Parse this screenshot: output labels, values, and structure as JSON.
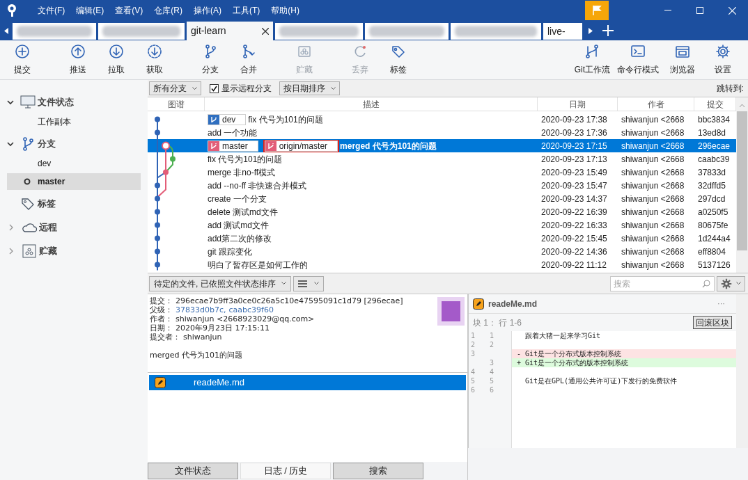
{
  "menu": [
    "文件(F)",
    "编辑(E)",
    "查看(V)",
    "仓库(R)",
    "操作(A)",
    "工具(T)",
    "帮助(H)"
  ],
  "tabs": [
    {
      "kind": "blurred",
      "selected": false
    },
    {
      "kind": "blurred",
      "selected": false
    },
    {
      "kind": "named",
      "label": "git-learn",
      "selected": true
    },
    {
      "kind": "blurred",
      "selected": false
    },
    {
      "kind": "blurred",
      "selected": false
    },
    {
      "kind": "blurred",
      "selected": false
    },
    {
      "kind": "named",
      "label": "live-",
      "selected": false
    }
  ],
  "toolbar": {
    "left": [
      {
        "label": "提交",
        "disabled": false
      },
      {
        "label": "推送",
        "disabled": false
      },
      {
        "label": "拉取",
        "disabled": false
      },
      {
        "label": "获取",
        "disabled": false
      },
      {
        "label": "分支",
        "disabled": false
      },
      {
        "label": "合并",
        "disabled": false
      },
      {
        "label": "贮藏",
        "disabled": true
      },
      {
        "label": "丢弃",
        "disabled": true
      },
      {
        "label": "标签",
        "disabled": false
      }
    ],
    "right": [
      {
        "label": "Git工作流",
        "disabled": false
      },
      {
        "label": "命令行模式",
        "disabled": false
      },
      {
        "label": "浏览器",
        "disabled": false
      },
      {
        "label": "设置",
        "disabled": false
      }
    ]
  },
  "sidebar": [
    {
      "label": "文件状态",
      "kind": "expandable",
      "expanded": true,
      "children": [
        {
          "label": "工作副本",
          "current": false,
          "selected": false
        }
      ]
    },
    {
      "label": "分支",
      "kind": "expandable",
      "expanded": true,
      "children": [
        {
          "label": "dev",
          "current": false,
          "selected": false
        },
        {
          "label": "master",
          "current": true,
          "selected": true
        }
      ]
    },
    {
      "label": "标签",
      "kind": "plain"
    },
    {
      "label": "远程",
      "kind": "expandable",
      "expanded": false
    },
    {
      "label": "贮藏",
      "kind": "expandable",
      "expanded": false
    }
  ],
  "filter_bar": {
    "branches": "所有分支",
    "show_remote": {
      "label": "显示远程分支",
      "checked": true
    },
    "sort": "按日期排序",
    "jump_to": "跳转到:"
  },
  "commit_table": {
    "columns": [
      "图谱",
      "描述",
      "日期",
      "作者",
      "提交"
    ],
    "rows": [
      {
        "refs": [
          {
            "name": "dev",
            "kind": "local",
            "boxed": false
          }
        ],
        "description": "fix 代号为101的问题",
        "date": "2020-09-23 17:38",
        "author": "shiwanjun <2668",
        "commit": "bbc3834",
        "selected": false
      },
      {
        "refs": [],
        "description": "add 一个功能",
        "date": "2020-09-23 17:36",
        "author": "shiwanjun <2668",
        "commit": "13ed8d",
        "selected": false
      },
      {
        "refs": [
          {
            "name": "master",
            "kind": "current",
            "boxed": false
          },
          {
            "name": "origin/master",
            "kind": "remote",
            "boxed": true
          }
        ],
        "description": "merged 代号为101的问题",
        "date": "2020-09-23 17:15",
        "author": "shiwanjun <2668",
        "commit": "296ecae",
        "selected": true
      },
      {
        "refs": [],
        "description": "fix 代号为101的问题",
        "date": "2020-09-23 17:13",
        "author": "shiwanjun <2668",
        "commit": "caabc39",
        "selected": false
      },
      {
        "refs": [],
        "description": "merge 非no-ff模式",
        "date": "2020-09-23 15:49",
        "author": "shiwanjun <2668",
        "commit": "37833d",
        "selected": false
      },
      {
        "refs": [],
        "description": "add --no-ff 非快速合并模式",
        "date": "2020-09-23 15:47",
        "author": "shiwanjun <2668",
        "commit": "32dffd5",
        "selected": false
      },
      {
        "refs": [],
        "description": "create 一个分支",
        "date": "2020-09-23 14:37",
        "author": "shiwanjun <2668",
        "commit": "297dcd",
        "selected": false
      },
      {
        "refs": [],
        "description": "delete 测试md文件",
        "date": "2020-09-22 16:39",
        "author": "shiwanjun <2668",
        "commit": "a0250f5",
        "selected": false
      },
      {
        "refs": [],
        "description": "add 测试md文件",
        "date": "2020-09-22 16:33",
        "author": "shiwanjun <2668",
        "commit": "80675fe",
        "selected": false
      },
      {
        "refs": [],
        "description": "add第二次的修改",
        "date": "2020-09-22 15:45",
        "author": "shiwanjun <2668",
        "commit": "1d244a4",
        "selected": false
      },
      {
        "refs": [],
        "description": "git 跟踪变化",
        "date": "2020-09-22 14:36",
        "author": "shiwanjun <2668",
        "commit": "eff8804",
        "selected": false
      },
      {
        "refs": [],
        "description": "明白了暂存区是如何工作的",
        "date": "2020-09-22 11:12",
        "author": "shiwanjun <2668",
        "commit": "5137126",
        "selected": false
      }
    ]
  },
  "details_toolbar": {
    "file_sort": "待定的文件, 已依照文件状态排序",
    "search_placeholder": "搜索"
  },
  "commit_details": {
    "fields": [
      {
        "label": "提交：",
        "value": "296ecae7b9ff3a0ce0c26a5c10e47595091c1d79 [296ecae]"
      },
      {
        "label": "父级：",
        "links": [
          "37833d0b7c",
          "caabc39f60"
        ],
        "separator": ","
      },
      {
        "label": "作者：",
        "value": "shiwanjun <2668923029@qq.com>"
      },
      {
        "label": "日期：",
        "value": "2020年9月23日 17:15:11"
      },
      {
        "label": "提交者：",
        "value": "shiwanjun"
      }
    ],
    "message": "merged 代号为101的问题"
  },
  "files": [
    {
      "name": "readeMe.md",
      "selected": true
    }
  ],
  "diff": {
    "file": "readeMe.md",
    "menu": "···",
    "hunk": "块 1： 行 1-6",
    "revert_button": "回滚区块",
    "lines": [
      {
        "kind": "context",
        "old": "1",
        "new": "1",
        "text": "跟着大猪一起来学习Git"
      },
      {
        "kind": "context",
        "old": "2",
        "new": "2"
      },
      {
        "kind": "removed",
        "old": "3",
        "text": "- Git是一个分布式版本控制系统"
      },
      {
        "kind": "added",
        "new": "3",
        "text": "+ Git是一个分布式的版本控制系统"
      },
      {
        "kind": "context",
        "old": "4",
        "new": "4"
      },
      {
        "kind": "context",
        "old": "5",
        "new": "5",
        "text": "Git是在GPL(通用公共许可证)下发行的免费软件"
      },
      {
        "kind": "context",
        "old": "6",
        "new": "6"
      }
    ]
  },
  "bottom_tabs": [
    {
      "label": "文件状态",
      "selected": false
    },
    {
      "label": "日志 / 历史",
      "selected": true
    },
    {
      "label": "搜索",
      "selected": false
    }
  ]
}
